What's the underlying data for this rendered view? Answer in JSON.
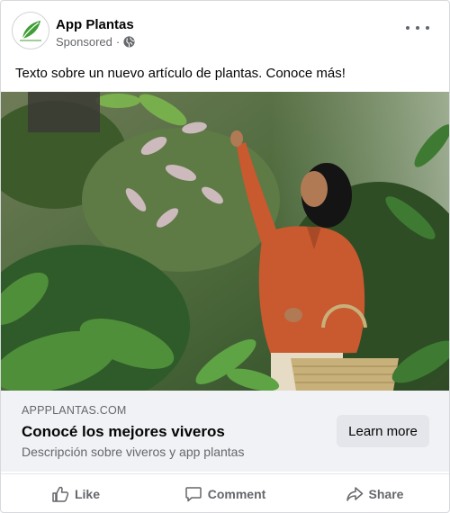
{
  "post": {
    "page_name": "App Plantas",
    "sponsored_label": "Sponsored",
    "separator": "·",
    "privacy_icon": "globe-icon",
    "menu_icon": "more-options-icon",
    "text": "Texto sobre un nuevo artículo de plantas. Conoce más!"
  },
  "ad": {
    "domain": "APPPLANTAS.COM",
    "headline": "Conocé los mejores viveros",
    "description": "Descripción sobre viveros y app plantas",
    "cta_label": "Learn more"
  },
  "actions": [
    {
      "label": "Like",
      "icon": "like-icon"
    },
    {
      "label": "Comment",
      "icon": "comment-icon"
    },
    {
      "label": "Share",
      "icon": "share-icon"
    }
  ],
  "colors": {
    "secondary_text": "#65676b",
    "ad_panel_bg": "#f0f2f5",
    "button_bg": "#e4e6eb",
    "logo_green": "#3f9e36"
  }
}
